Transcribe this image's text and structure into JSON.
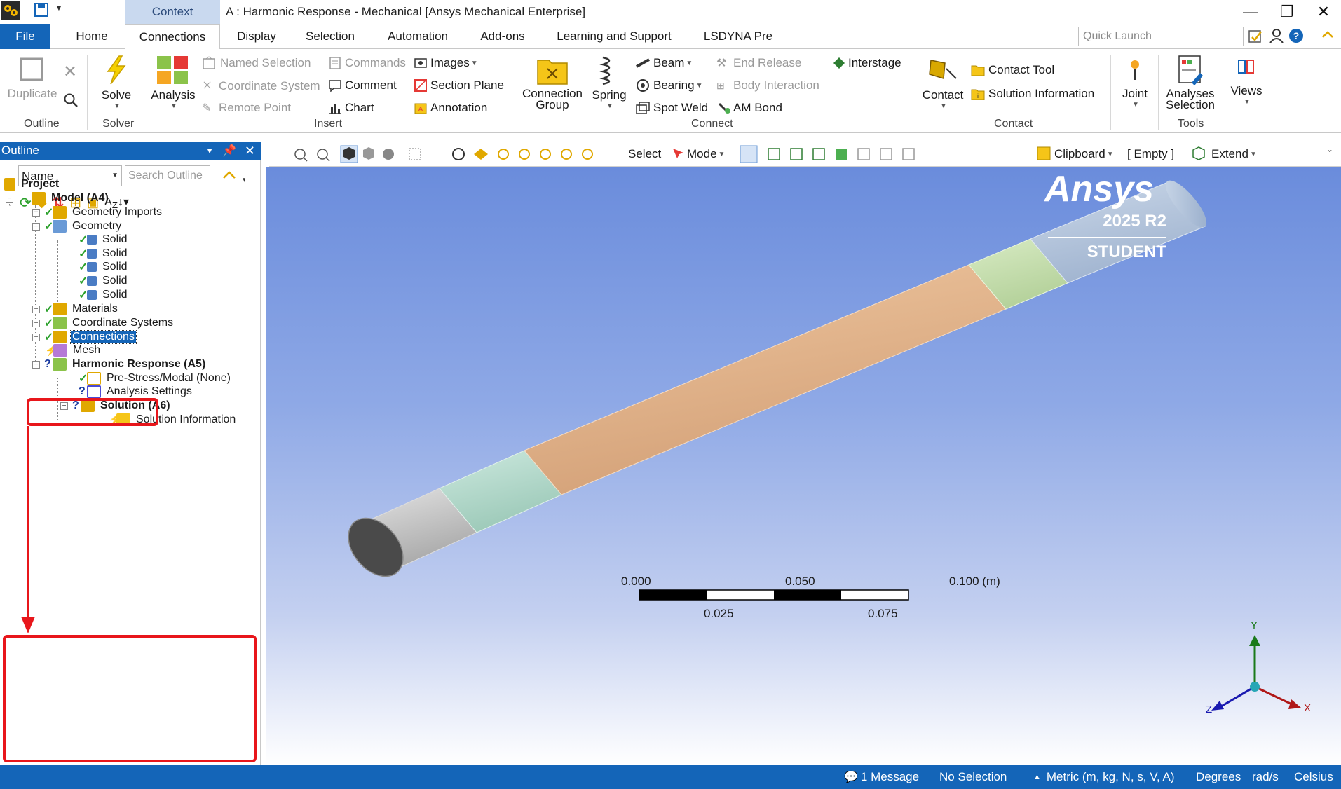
{
  "titlebar": {
    "context_tab": "Context",
    "title": "A : Harmonic Response - Mechanical [Ansys Mechanical Enterprise]",
    "minimize": "—",
    "restore": "❐",
    "close": "✕"
  },
  "menu": {
    "tabs": [
      {
        "id": "file",
        "label": "File"
      },
      {
        "id": "home",
        "label": "Home"
      },
      {
        "id": "connections",
        "label": "Connections"
      },
      {
        "id": "display",
        "label": "Display"
      },
      {
        "id": "selection",
        "label": "Selection"
      },
      {
        "id": "automation",
        "label": "Automation"
      },
      {
        "id": "addons",
        "label": "Add-ons"
      },
      {
        "id": "learning",
        "label": "Learning and Support"
      },
      {
        "id": "lsdyna",
        "label": "LSDYNA Pre"
      }
    ],
    "quick_launch_placeholder": "Quick Launch"
  },
  "ribbon": {
    "outline": {
      "label": "Outline",
      "duplicate": "Duplicate"
    },
    "solver": {
      "label": "Solver",
      "solve": "Solve"
    },
    "insert": {
      "label": "Insert",
      "analysis": "Analysis",
      "named_selection": "Named Selection",
      "coordinate_system": "Coordinate System",
      "remote_point": "Remote Point",
      "commands": "Commands",
      "comment": "Comment",
      "chart": "Chart",
      "images": "Images",
      "section_plane": "Section Plane",
      "annotation": "Annotation"
    },
    "connect": {
      "label": "Connect",
      "connection_group_1": "Connection",
      "connection_group_2": "Group",
      "spring": "Spring",
      "beam": "Beam",
      "bearing": "Bearing",
      "spot_weld": "Spot Weld",
      "end_release": "End Release",
      "body_interaction": "Body Interaction",
      "am_bond": "AM Bond",
      "interstage": "Interstage"
    },
    "contact": {
      "label": "Contact",
      "contact": "Contact",
      "contact_tool": "Contact Tool",
      "solution_information": "Solution Information"
    },
    "joint": "Joint",
    "tools": {
      "label": "Tools",
      "analyses_selection_1": "Analyses",
      "analyses_selection_2": "Selection"
    },
    "views": "Views"
  },
  "outline": {
    "header": "Outline",
    "name_select": "Name",
    "search_placeholder": "Search Outline",
    "tree": {
      "project": "Project",
      "model": "Model (A4)",
      "geometry_imports": "Geometry Imports",
      "geometry": "Geometry",
      "solids": [
        "Solid",
        "Solid",
        "Solid",
        "Solid",
        "Solid"
      ],
      "materials": "Materials",
      "coordinate_systems": "Coordinate Systems",
      "connections": "Connections",
      "mesh": "Mesh",
      "harmonic_response": "Harmonic Response (A5)",
      "pre_stress": "Pre-Stress/Modal (None)",
      "analysis_settings": "Analysis Settings",
      "solution": "Solution (A6)",
      "solution_information": "Solution Information"
    }
  },
  "viewport_toolbar": {
    "select": "Select",
    "mode": "Mode",
    "clipboard": "Clipboard",
    "empty": "[ Empty ]",
    "extend": "Extend"
  },
  "viewport": {
    "brand": "Ansys",
    "version": "2025 R2",
    "edition": "STUDENT",
    "scale_top": [
      "0.000",
      "0.050",
      "0.100 (m)"
    ],
    "scale_bottom": [
      "0.025",
      "0.075"
    ],
    "axes": {
      "x": "X",
      "y": "Y",
      "z": "Z"
    },
    "colors": {
      "gray": "#c8c8c8",
      "teal": "#b9dccf",
      "tan": "#e3b58c",
      "green": "#c9e0b2",
      "steel": "#b7c8de"
    }
  },
  "statusbar": {
    "messages": "1 Message",
    "selection": "No Selection",
    "units": "Metric (m, kg, N, s, V, A)",
    "angle": "Degrees",
    "rate": "rad/s",
    "temperature": "Celsius"
  }
}
